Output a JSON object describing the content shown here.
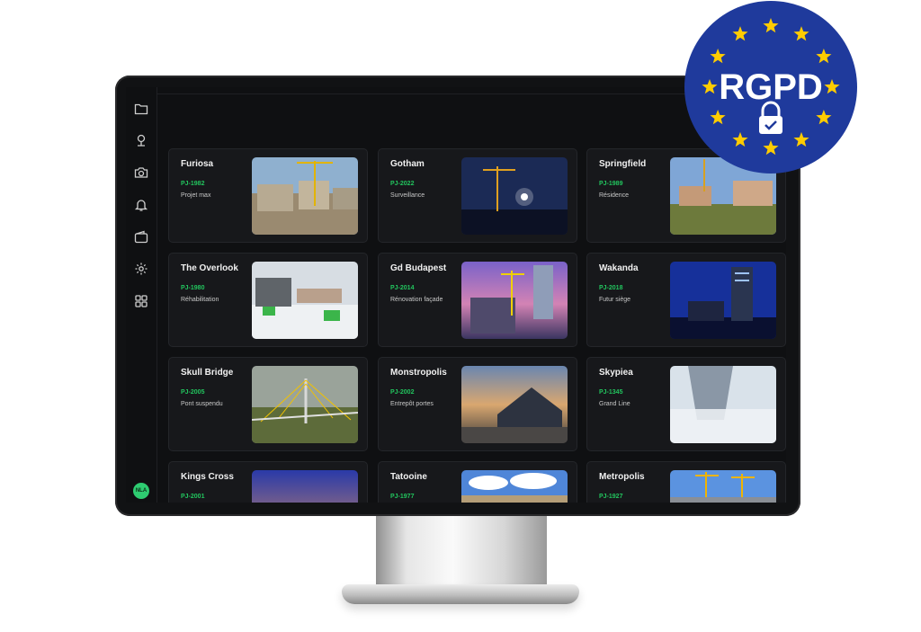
{
  "sidebar": {
    "items": [
      {
        "icon": "folder-icon"
      },
      {
        "icon": "map-pin-icon"
      },
      {
        "icon": "camera-icon"
      },
      {
        "icon": "bell-icon"
      },
      {
        "icon": "wallet-icon"
      },
      {
        "icon": "gear-icon"
      },
      {
        "icon": "grid-icon"
      }
    ],
    "avatar_initials": "NLA"
  },
  "projects": [
    {
      "name": "Furiosa",
      "code": "PJ-1982",
      "description": "Projet max"
    },
    {
      "name": "Gotham",
      "code": "PJ-2022",
      "description": "Surveillance"
    },
    {
      "name": "Springfield",
      "code": "PJ-1989",
      "description": "Résidence"
    },
    {
      "name": "The Overlook",
      "code": "PJ-1980",
      "description": "Réhabilitation"
    },
    {
      "name": "Gd Budapest",
      "code": "PJ-2014",
      "description": "Rénovation façade"
    },
    {
      "name": "Wakanda",
      "code": "PJ-2018",
      "description": "Futur siège"
    },
    {
      "name": "Skull Bridge",
      "code": "PJ-2005",
      "description": "Pont suspendu"
    },
    {
      "name": "Monstropolis",
      "code": "PJ-2002",
      "description": "Entrepôt portes"
    },
    {
      "name": "Skypiea",
      "code": "PJ-1345",
      "description": "Grand Line"
    },
    {
      "name": "Kings Cross",
      "code": "PJ-2001",
      "description": ""
    },
    {
      "name": "Tatooine",
      "code": "PJ-1977",
      "description": ""
    },
    {
      "name": "Metropolis",
      "code": "PJ-1927",
      "description": ""
    }
  ],
  "badge": {
    "text": "RGPD",
    "background": "#1f3a9c",
    "star_color": "#ffcc00"
  },
  "colors": {
    "accent_green": "#22c55e",
    "card_bg": "#17181b",
    "screen_bg": "#0f1012"
  }
}
